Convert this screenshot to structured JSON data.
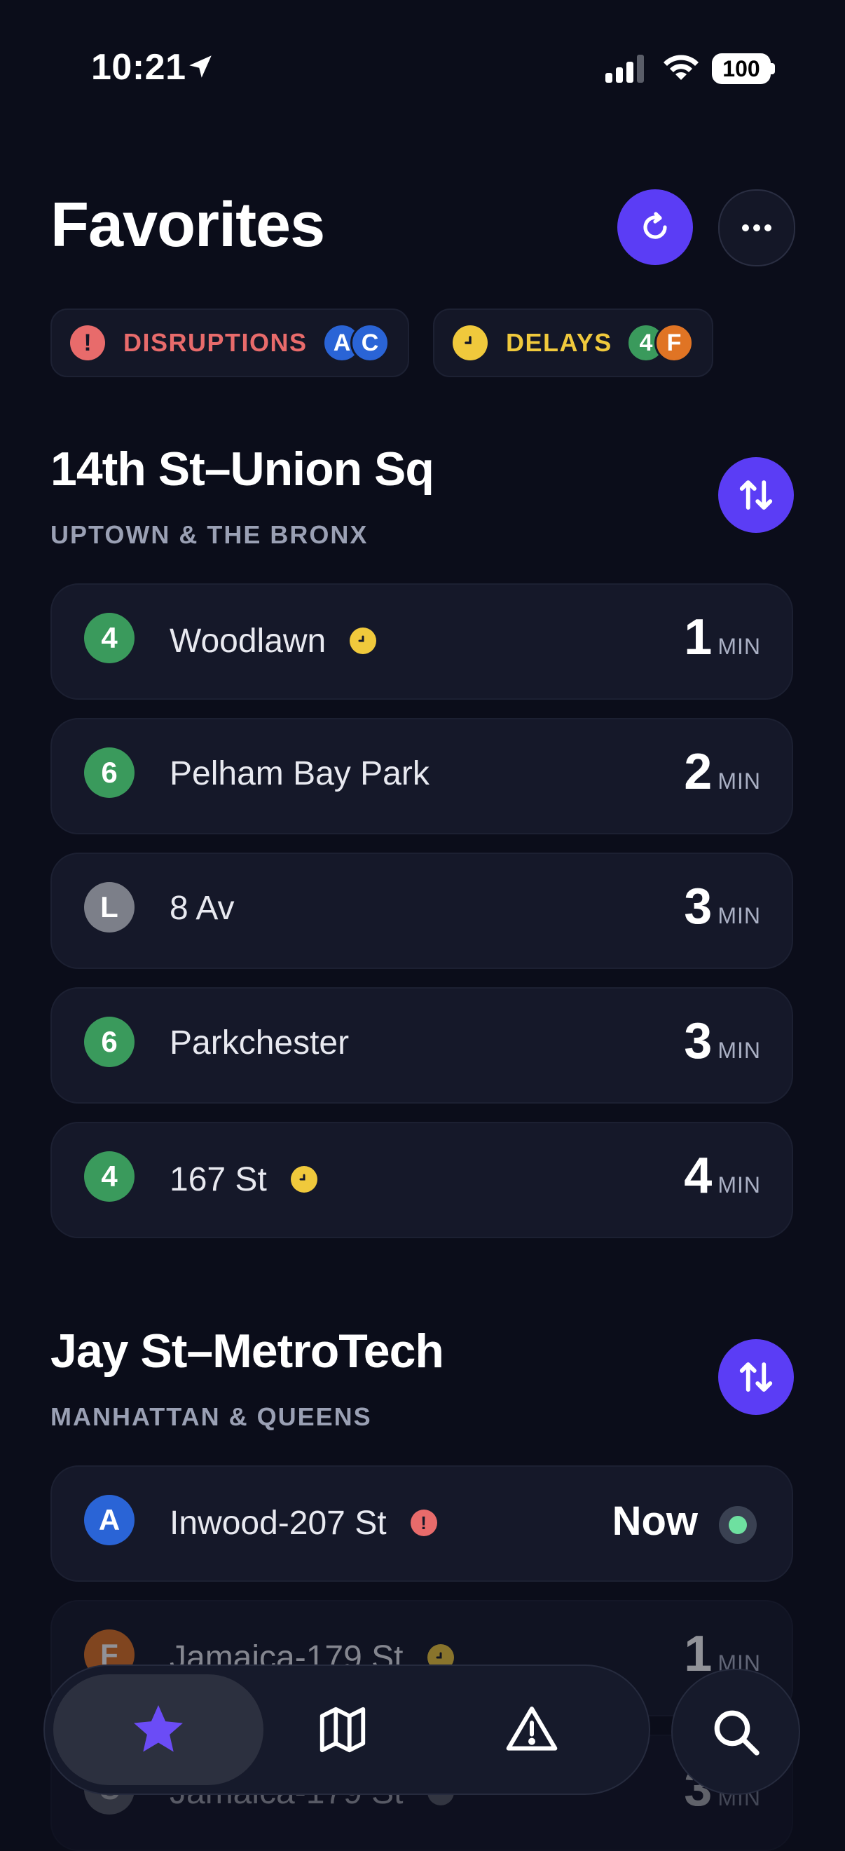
{
  "status_bar": {
    "time": "10:21",
    "battery": "100"
  },
  "header": {
    "title": "Favorites"
  },
  "alerts": {
    "disruptions": {
      "label": "DISRUPTIONS",
      "icon": "!",
      "lines": [
        "A",
        "C"
      ]
    },
    "delays": {
      "label": "DELAYS",
      "lines": [
        "4",
        "F"
      ]
    }
  },
  "stations": [
    {
      "name": "14th St–Union Sq",
      "direction": "UPTOWN & THE BRONX",
      "arrivals": [
        {
          "line": "4",
          "color": "#3a9a5c",
          "destination": "Woodlawn",
          "flag": "delay",
          "eta": "1",
          "unit": "MIN"
        },
        {
          "line": "6",
          "color": "#3a9a5c",
          "destination": "Pelham Bay Park",
          "eta": "2",
          "unit": "MIN"
        },
        {
          "line": "L",
          "color": "#7c7f89",
          "destination": "8 Av",
          "eta": "3",
          "unit": "MIN"
        },
        {
          "line": "6",
          "color": "#3a9a5c",
          "destination": "Parkchester",
          "eta": "3",
          "unit": "MIN"
        },
        {
          "line": "4",
          "color": "#3a9a5c",
          "destination": "167 St",
          "flag": "delay",
          "eta": "4",
          "unit": "MIN"
        }
      ]
    },
    {
      "name": "Jay St–MetroTech",
      "direction": "MANHATTAN & QUEENS",
      "arrivals": [
        {
          "line": "A",
          "color": "#2a64d6",
          "destination": "Inwood-207 St",
          "flag": "disruption",
          "flag_icon": "!",
          "eta": "Now"
        },
        {
          "line": "F",
          "color": "#e07424",
          "destination": "Jamaica-179 St",
          "flag": "delay",
          "eta": "1",
          "unit": "MIN"
        },
        {
          "line": "C",
          "color": "#7c7f89",
          "destination": "Jamaica-179 St",
          "flag": "delay",
          "eta": "3",
          "unit": "MIN"
        }
      ]
    }
  ],
  "tabbar": {
    "tabs": [
      "favorites-star-icon",
      "map-icon",
      "alerts-warning-icon"
    ],
    "search": "search-icon"
  },
  "colors": {
    "accent": "#5b3df5",
    "background": "#0b0d1a",
    "disruption": "#e86b6b",
    "delay": "#f0c93c"
  }
}
